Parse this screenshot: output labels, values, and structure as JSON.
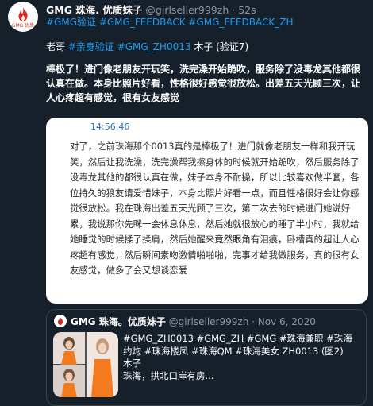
{
  "tweet": {
    "author_name": "GMG 珠海. 优质妹子",
    "author_handle": "@girlseller999zh",
    "separator": "·",
    "time": "52s",
    "avatar_caption": "GMG 优质",
    "hashtags": "#GMG验证 #GMG_FEEDBACK #GMG_FEEDBACK_ZH",
    "meta": {
      "prefix": "老哥 ",
      "tag1": "#亲身验证",
      "tag2": " #GMG_ZH0013",
      "suffix": " 木子 (验证7)"
    },
    "text": "棒极了！进门像老朋友开玩笑，洗完澡开始跪吹，服务除了没毒龙其他都很认真在做。本身比照片好看，性格很好感觉很放松。出差五天光顾三次，让人心疼超有感觉，很有女友感觉"
  },
  "screenshot_card": {
    "time": "14:56:46",
    "text": "对了，之前珠海那个0013真的是棒极了！进门就像老朋友一样和我开玩笑，然后让我洗澡，洗完澡帮我擦身体的时候就开始跪吹，然后服务除了没毒龙其他的都很认真在做，妹子本身不耐操，所以比较喜欢做半套，各位持久的狼友请爱惜妹子，本身比照片好看一点，而且性格很好会让你感觉很放松。我在珠海出差五天光顾了三次，第二次去的时候进门她说好累，我说那你先眯一会休息休息，然后她就很放心的睡了半小时，我就给她睡觉的时候揉了揉肩，然后她醒来竟然眼角有泪痕，卧槽真的超让人心疼超有感觉，然后瞬间素吻激情啪啪啪，完事才给我做服务，真的很有女友感觉，做多了会又想谈恋爱"
  },
  "quoted": {
    "author_name": "GMG 珠海。优质妹子",
    "author_handle": "@girlseller999zh",
    "separator": "·",
    "date": "Nov 6, 2020",
    "tags": "#GMG_ZH0013 #GMG_ZH #GMG #珠海兼职 #珠海约炮 #珠海楼凤 #珠海QM #珠海美女 ZH0013 (图2)",
    "name_line": "木子",
    "location_line": "珠海，拱北口岸有房..."
  },
  "colors": {
    "background": "#15202b",
    "link_blue": "#1d9bf0",
    "muted_gray": "#8899a6",
    "card_white": "#ffffff"
  }
}
